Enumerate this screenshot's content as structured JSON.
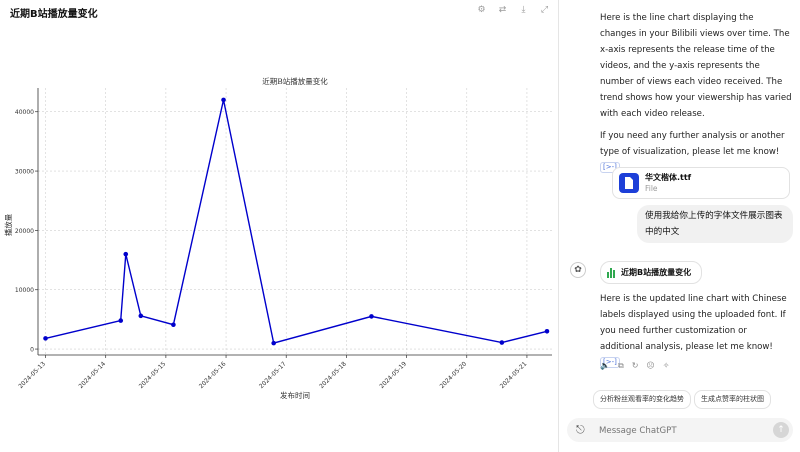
{
  "panel": {
    "title": "近期B站播放量变化",
    "toolbar": [
      {
        "name": "settings-icon",
        "glyph": "⚙"
      },
      {
        "name": "switch-icon",
        "glyph": "⇄"
      },
      {
        "name": "download-icon",
        "glyph": "⤓"
      },
      {
        "name": "expand-icon",
        "glyph": "⤢"
      }
    ]
  },
  "chart_data": {
    "type": "line",
    "title": "近期B站播放量变化",
    "xlabel": "发布时间",
    "ylabel": "播放量",
    "x_ticks": [
      "2024-05-13",
      "2024-05-14",
      "2024-05-15",
      "2024-05-16",
      "2024-05-17",
      "2024-05-18",
      "2024-05-19",
      "2024-05-20",
      "2024-05-21"
    ],
    "y_ticks": [
      0,
      10000,
      20000,
      30000,
      40000
    ],
    "ylim": [
      -1000,
      44000
    ],
    "xlim": [
      "2024-05-12 21:00",
      "2024-05-21 10:00"
    ],
    "grid": true,
    "line_color": "#0000cc",
    "points": [
      {
        "x": "2024-05-13 00:00",
        "y": 1800
      },
      {
        "x": "2024-05-14 06:00",
        "y": 4800
      },
      {
        "x": "2024-05-14 08:00",
        "y": 16000
      },
      {
        "x": "2024-05-14 14:00",
        "y": 5600
      },
      {
        "x": "2024-05-15 03:00",
        "y": 4100
      },
      {
        "x": "2024-05-15 23:00",
        "y": 42000
      },
      {
        "x": "2024-05-16 19:00",
        "y": 1000
      },
      {
        "x": "2024-05-18 10:00",
        "y": 5500
      },
      {
        "x": "2024-05-20 14:00",
        "y": 1100
      },
      {
        "x": "2024-05-21 08:00",
        "y": 3000
      }
    ]
  },
  "chat": {
    "message1": "Here is the line chart displaying the changes in your Bilibili views over time. The x-axis represents the release time of the videos, and the y-axis represents the number of views each video received. The trend shows how your viewership has varied with each video release.",
    "message2": "If you need any further analysis or another type of visualization, please let me know!",
    "cite": "[>-]",
    "file": {
      "name": "华文楷体.ttf",
      "type": "File"
    },
    "user_message": "使用我给你上传的字体文件展示图表中的中文",
    "chip_label": "近期B站播放量变化",
    "message3": "Here is the updated line chart with Chinese labels displayed using the uploaded font. If you need further customization or additional analysis, please let me know!",
    "actions": [
      {
        "name": "read-aloud-icon",
        "glyph": "🔈"
      },
      {
        "name": "copy-icon",
        "glyph": "⧉"
      },
      {
        "name": "regenerate-icon",
        "glyph": "↻"
      },
      {
        "name": "thumbs-down-icon",
        "glyph": "☹"
      },
      {
        "name": "sparkle-icon",
        "glyph": "✧"
      }
    ],
    "suggestions": [
      "分析粉丝观看率的变化趋势",
      "生成点赞率的柱状图"
    ],
    "composer_placeholder": "Message ChatGPT",
    "send_glyph": "↑"
  }
}
